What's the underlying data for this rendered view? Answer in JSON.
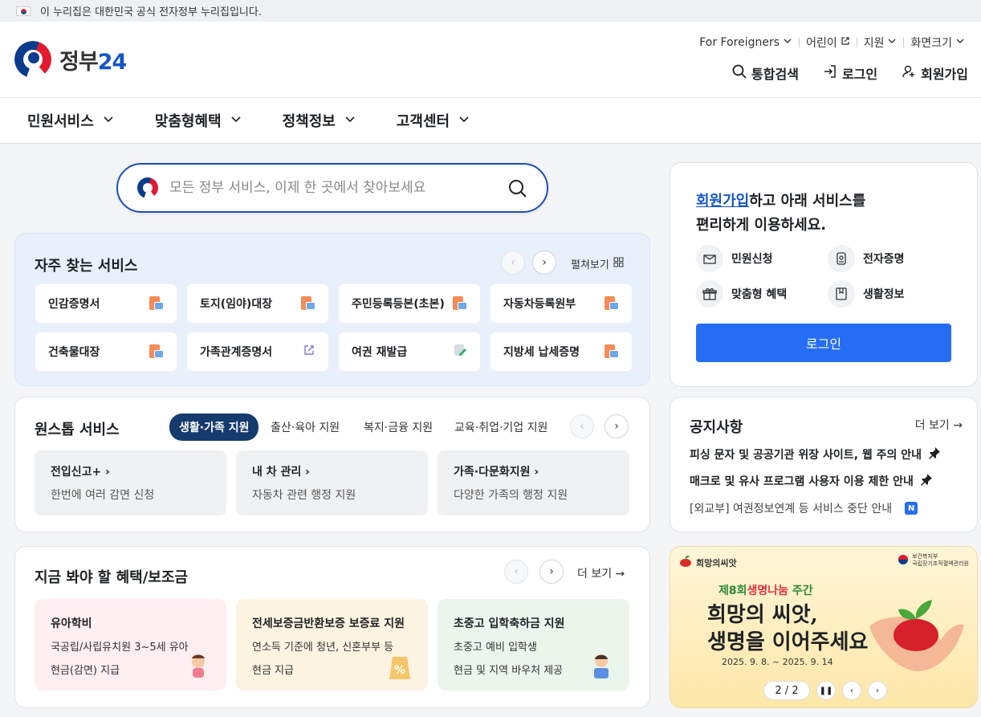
{
  "gov_banner": {
    "text": "이 누리집은 대한민국 공식 전자정부 누리집입니다."
  },
  "logo": {
    "text_main": "정부",
    "text_num": "24"
  },
  "utility": {
    "for_foreigners": "For Foreigners",
    "kids": "어린이",
    "support": "지원",
    "font_size": "화면크기",
    "search": "통합검색",
    "login": "로그인",
    "signup": "회원가입"
  },
  "gnb": [
    "민원서비스",
    "맞춤형혜택",
    "정책정보",
    "고객센터"
  ],
  "search": {
    "placeholder": "모든 정부 서비스, 이제 한 곳에서 찾아보세요"
  },
  "frequent": {
    "title": "자주 찾는 서비스",
    "expand": "펼쳐보기",
    "items": [
      {
        "label": "인감증명서",
        "icon": "document-icon"
      },
      {
        "label": "토지(임야)대장",
        "icon": "document-icon"
      },
      {
        "label": "주민등록등본(초본)",
        "icon": "document-icon"
      },
      {
        "label": "자동차등록원부",
        "icon": "document-icon"
      },
      {
        "label": "건축물대장",
        "icon": "document-icon"
      },
      {
        "label": "가족관계증명서",
        "icon": "external-link-icon"
      },
      {
        "label": "여권 재발급",
        "icon": "pen-icon"
      },
      {
        "label": "지방세 납세증명",
        "icon": "document-icon"
      }
    ]
  },
  "onestop": {
    "title": "원스톱 서비스",
    "tabs": [
      "생활·가족 지원",
      "출산·육아 지원",
      "복지·금융 지원",
      "교육·취업·기업 지원"
    ],
    "cards": [
      {
        "title": "전입신고+",
        "desc": "한번에 여러 감면 신청"
      },
      {
        "title": "내 차 관리",
        "desc": "자동차 관련 행정 지원"
      },
      {
        "title": "가족·다문화지원",
        "desc": "다양한 가족의 행정 지원"
      }
    ]
  },
  "benefits": {
    "title": "지금 봐야 할 혜택/보조금",
    "more": "더 보기",
    "cards": [
      {
        "title": "유아학비",
        "line1": "국공립/사립유치원 3~5세 유아",
        "line2": "현금(감면) 지급",
        "bg": "#fdeef0"
      },
      {
        "title": "전세보증금반환보증 보증료 지원",
        "line1": "연소득 기준에 청년, 신혼부부 등",
        "line2": "현금 지급",
        "bg": "#fdf3e1"
      },
      {
        "title": "초중고 입학축하금 지원",
        "line1": "초중고 예비 입학생",
        "line2": "현금 및 지역 바우처 제공",
        "bg": "#eaf5ec"
      }
    ]
  },
  "login_box": {
    "msg_link": "회원가입",
    "msg_rest1": "하고 아래 서비스를",
    "msg_line2": "편리하게 이용하세요.",
    "quick": [
      "민원신청",
      "전자증명",
      "맞춤형 혜택",
      "생활정보"
    ],
    "button": "로그인"
  },
  "notice": {
    "title": "공지사항",
    "more": "더 보기",
    "items": [
      "피싱 문자 및 공공기관 위장 사이트, 웹 주의 안내",
      "매크로 및 유사 프로그램 사용자 이용 제한 안내",
      "[외교부] 여권정보연계 등 서비스 중단 안내"
    ],
    "new_badge": "N"
  },
  "banner": {
    "brand": "희망의씨앗",
    "org1": "보건복지부",
    "org2": "국립장기조직혈액관리원",
    "headline_a": "제8회",
    "headline_b": "생명나눔",
    "headline_c": " 주간",
    "slogan1": "희망의 씨앗,",
    "slogan2": "생명을 이어주세요",
    "date": "2025. 9. 8. ~ 2025. 9. 14",
    "page": "2 / 2"
  },
  "colors": {
    "primary": "#256ef4",
    "brand_blue": "#1657c5",
    "tab_active": "#153a6e"
  }
}
